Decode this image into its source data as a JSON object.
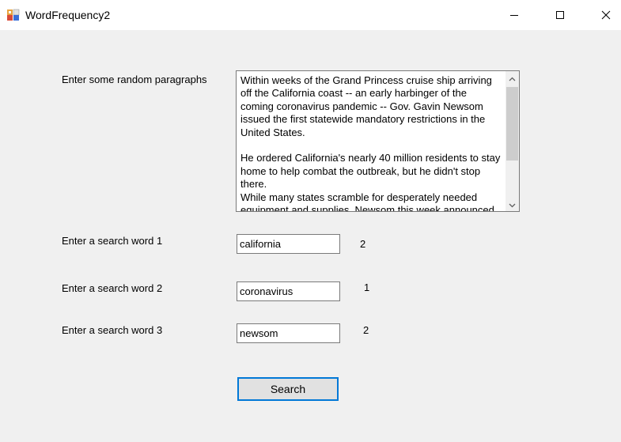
{
  "window": {
    "title": "WordFrequency2"
  },
  "form": {
    "paragraphs_label": "Enter some random paragraphs",
    "paragraphs_text": "Within weeks of the Grand Princess cruise ship arriving\noff the California coast -- an early harbinger of the\ncoming coronavirus pandemic -- Gov. Gavin Newsom\nissued the first statewide mandatory restrictions in the\nUnited States.\n\nHe ordered California's nearly 40 million residents to stay\nhome to help combat the outbreak, but he didn't stop\nthere.\nWhile many states scramble for desperately needed\nequipment and supplies, Newsom this week announced",
    "word1_label": "Enter a search word 1",
    "word1_value": "california",
    "word1_count": "2",
    "word2_label": "Enter a search word 2",
    "word2_value": "coronavirus",
    "word2_count": "1",
    "word3_label": "Enter a search word 3",
    "word3_value": "newsom",
    "word3_count": "2",
    "search_button": "Search"
  },
  "icons": {
    "app": "app-icon",
    "minimize": "minimize-icon",
    "maximize": "maximize-icon",
    "close": "close-icon",
    "scroll_up": "chevron-up-icon",
    "scroll_down": "chevron-down-icon"
  },
  "colors": {
    "focus_border": "#0078d7",
    "window_bg": "#f0f0f0"
  }
}
